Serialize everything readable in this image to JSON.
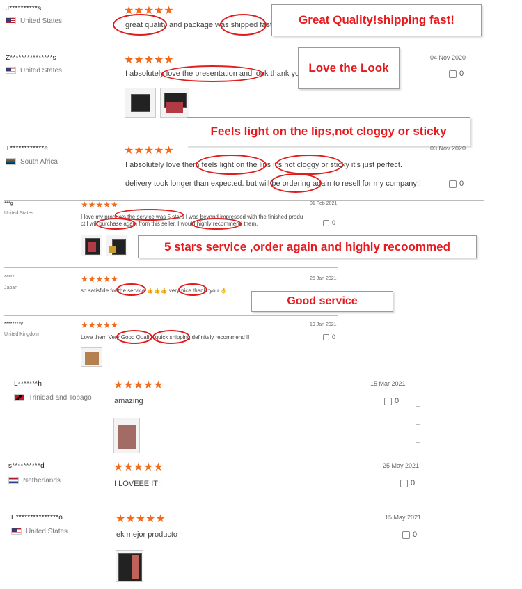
{
  "colors": {
    "star": "#f26a1b",
    "annotation": "#e8191c",
    "oval": "#e31b1b"
  },
  "reviews": [
    {
      "name": "J**********s",
      "country": "United States",
      "flag": "us-flag",
      "text": "great quality and package was shipped fast.",
      "date": "",
      "likes": "",
      "note": "Great Quality!shipping fast!",
      "rating": 5
    },
    {
      "name": "Z***************s",
      "country": "United States",
      "flag": "us-flag",
      "text": "I absolutely love the presentation and look thank you",
      "date": "04 Nov 2020",
      "likes": "0",
      "note": "Love the Look",
      "rating": 5
    },
    {
      "name": "T************e",
      "country": "South Africa",
      "flag": "za-flag",
      "text": "I absolutely love them feels light on the lips it's not cloggy or sticky it's just perfect.",
      "text2": "delivery took longer than expected. but will be ordering again to resell for my company!!",
      "date": "03 Nov 2020",
      "likes": "0",
      "note": "Feels light on the lips,not cloggy or sticky",
      "rating": 5
    },
    {
      "name": "***g",
      "country": "United States",
      "flag": "",
      "text": "I love my products the service was 5 stars I was beyond impressed with the finished produ",
      "text2": "ct I will purchase again from this seller. I would highly recommend them.",
      "date": "01 Feb 2021",
      "likes": "0",
      "note": "5 stars service ,order again and highly recoommed",
      "rating": 5
    },
    {
      "name": "*****i",
      "country": "Japan",
      "flag": "",
      "text": "so satisfide for the service 👍👍👍 very nice thankbyou 👌",
      "date": "25 Jan 2021",
      "likes": "",
      "note": "Good service",
      "rating": 5
    },
    {
      "name": "********v",
      "country": "United Kingdom",
      "flag": "",
      "text": "Love them Very Good Quality quick shipping definitely recommend !!",
      "date": "19 Jan 2021",
      "likes": "0",
      "note": "",
      "rating": 5
    },
    {
      "name": "L*******h",
      "country": "Trinidad and Tobago",
      "flag": "tt-flag",
      "text": "amazing",
      "date": "15 Mar 2021",
      "likes": "0",
      "note": "",
      "rating": 5
    },
    {
      "name": "s**********d",
      "country": "Netherlands",
      "flag": "nl-flag",
      "text": "I LOVEEE IT!!",
      "date": "25 May 2021",
      "likes": "0",
      "note": "",
      "rating": 5
    },
    {
      "name": "E***************o",
      "country": "United States",
      "flag": "us-flag",
      "text": "ek mejor producto",
      "date": "15 May 2021",
      "likes": "0",
      "note": "",
      "rating": 5
    }
  ],
  "star_glyphs": "★★★★★"
}
